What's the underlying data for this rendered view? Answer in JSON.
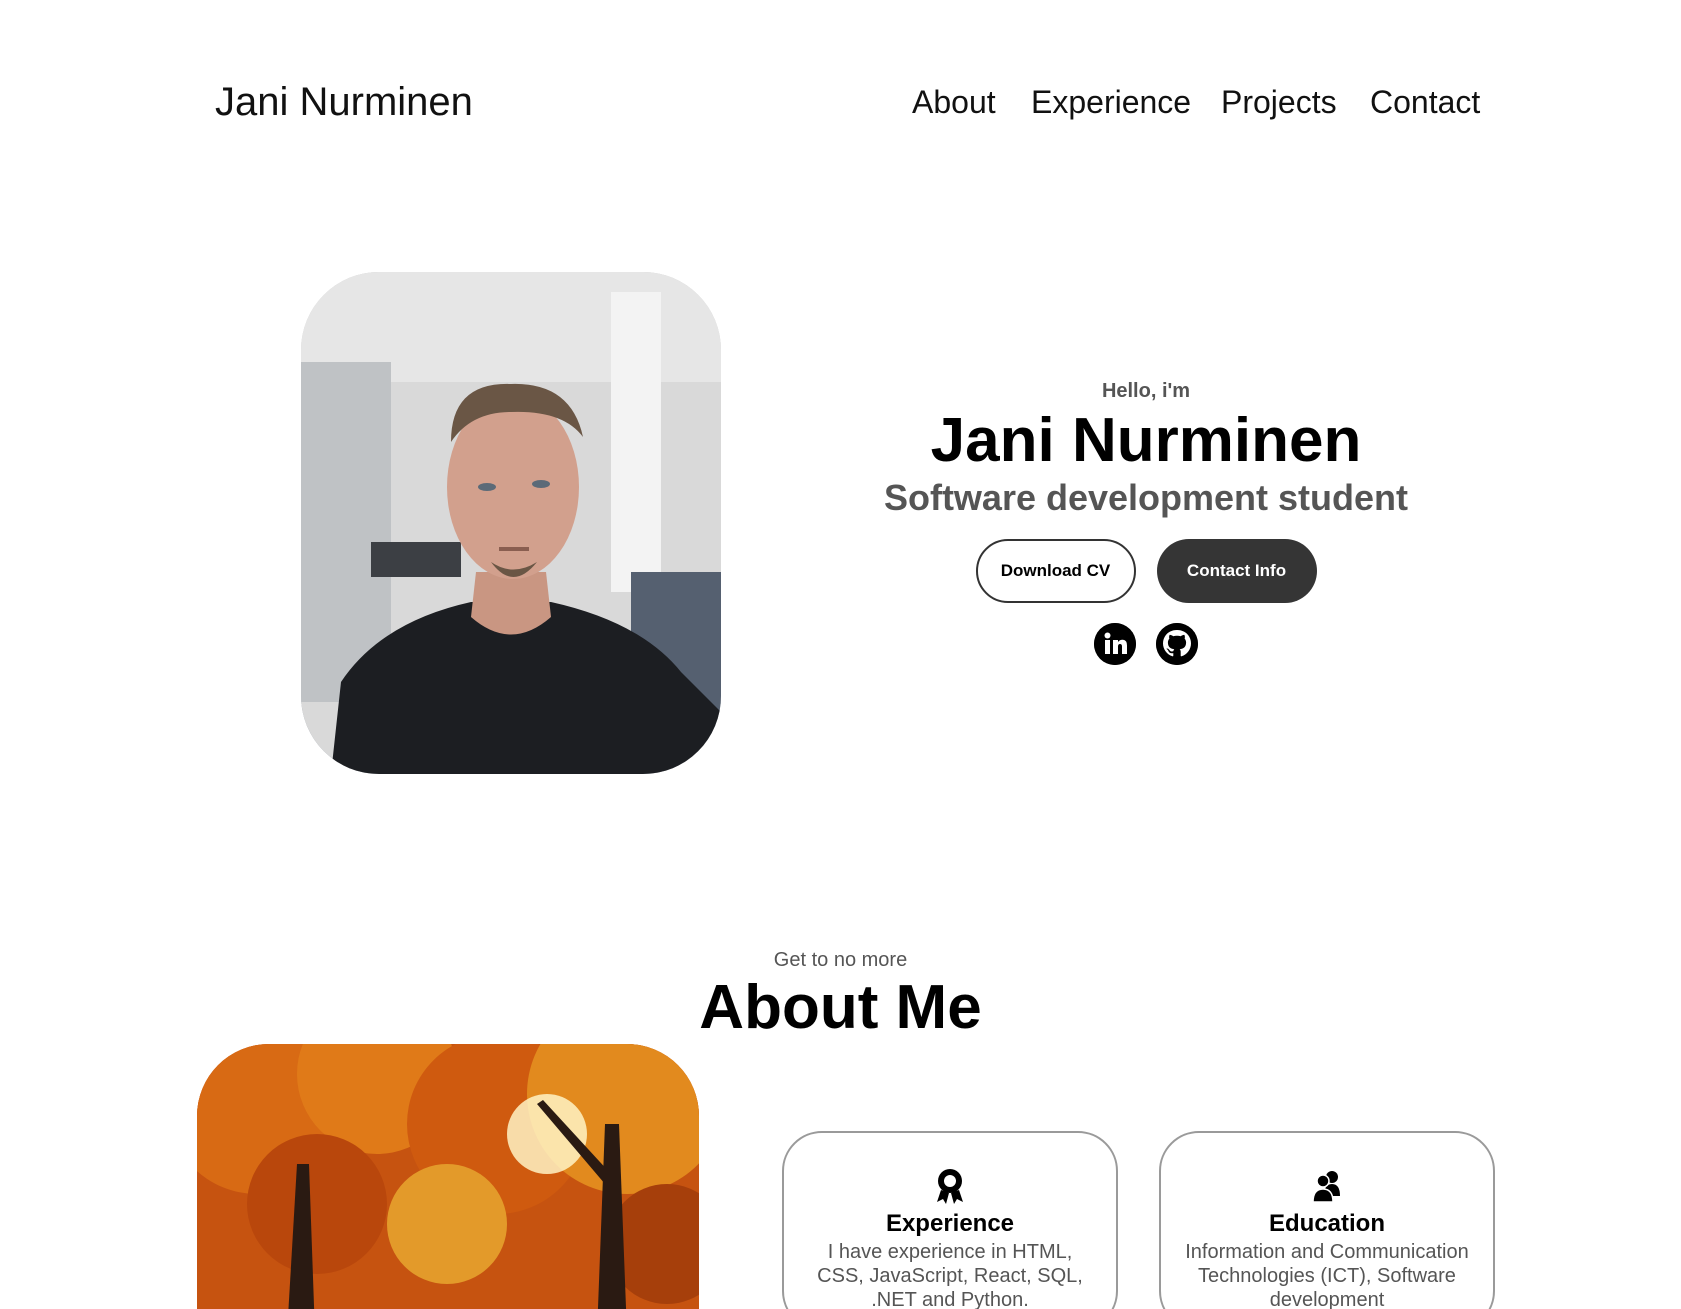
{
  "nav": {
    "logo": "Jani Nurminen",
    "links": [
      "About",
      "Experience",
      "Projects",
      "Contact"
    ]
  },
  "hero": {
    "greeting": "Hello, i'm",
    "name": "Jani Nurminen",
    "role": "Software development student",
    "buttons": {
      "download_cv": "Download CV",
      "contact_info": "Contact Info"
    },
    "socials": {
      "linkedin_icon": "linkedin-icon",
      "github_icon": "github-icon"
    }
  },
  "about": {
    "subtitle": "Get to no more",
    "title": "About Me",
    "cards": [
      {
        "icon": "award-icon",
        "title": "Experience",
        "text": "I have experience in HTML, CSS, JavaScript, React, SQL, .NET and Python."
      },
      {
        "icon": "users-icon",
        "title": "Education",
        "text": "Information and Communication Technologies (ICT), Software development"
      }
    ]
  }
}
